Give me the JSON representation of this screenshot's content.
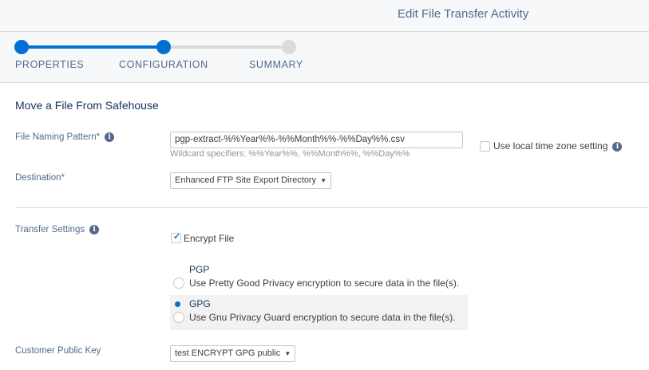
{
  "header": {
    "title": "Edit File Transfer Activity"
  },
  "steps": [
    {
      "label": "PROPERTIES",
      "state": "done"
    },
    {
      "label": "CONFIGURATION",
      "state": "current"
    },
    {
      "label": "SUMMARY",
      "state": "todo"
    }
  ],
  "section": {
    "title": "Move a File From Safehouse"
  },
  "file_naming": {
    "label": "File Naming Pattern*",
    "value": "pgp-extract-%%Year%%-%%Month%%-%%Day%%.csv",
    "hint": "Wildcard specifiers: %%Year%%, %%Month%%, %%Day%%"
  },
  "local_time": {
    "label": "Use local time zone setting",
    "checked": false
  },
  "destination": {
    "label": "Destination*",
    "value": "Enhanced FTP Site Export Directory"
  },
  "transfer": {
    "label": "Transfer Settings",
    "encrypt_label": "Encrypt File",
    "encrypt_checked": true,
    "options": [
      {
        "title": "PGP",
        "desc": "Use Pretty Good Privacy encryption to secure data in the file(s).",
        "selected": false
      },
      {
        "title": "GPG",
        "desc": "Use Gnu Privacy Guard encryption to secure data in the file(s).",
        "selected": true
      }
    ]
  },
  "public_key": {
    "label": "Customer Public Key",
    "value": "test ENCRYPT GPG public"
  },
  "icons": {
    "info": "info-icon",
    "caret": "chevron-down-icon",
    "check": "checkmark-icon"
  },
  "colors": {
    "accent": "#0070d2",
    "track_inactive": "#dddbda",
    "label": "#54698d"
  }
}
